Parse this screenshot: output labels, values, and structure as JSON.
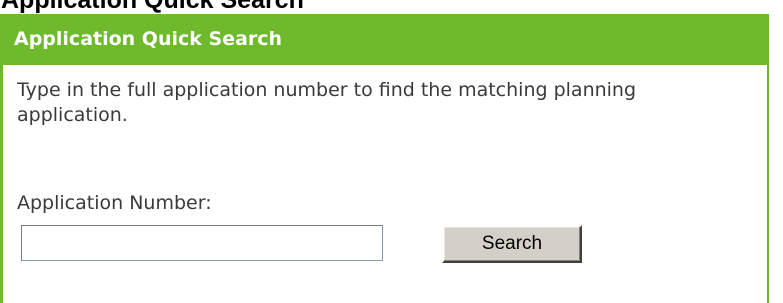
{
  "page": {
    "heading": "Application Quick Search"
  },
  "panel": {
    "title": "Application Quick Search",
    "description": "Type in the full application number to find the matching planning application.",
    "field_label": "Application Number:",
    "input_value": "",
    "search_button_label": "Search"
  },
  "colors": {
    "header_green": "#6eba2c",
    "border_green": "#6fb82b",
    "button_face": "#d4d0c8"
  }
}
